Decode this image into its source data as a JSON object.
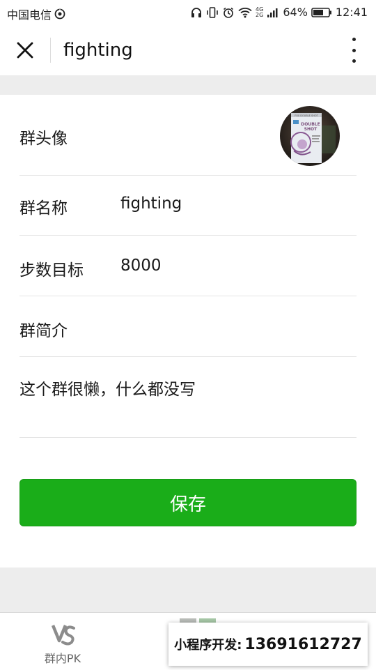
{
  "status_bar": {
    "carrier": "中国电信",
    "battery_percent": "64%",
    "time": "12:41",
    "network_top": "4G",
    "network_bottom": "2G",
    "icons": [
      "hotspot-icon",
      "headset-icon",
      "vibrate-icon",
      "alarm-icon",
      "wifi-icon",
      "signal-icon",
      "battery-icon"
    ]
  },
  "header": {
    "title": "fighting",
    "close_icon": "close-icon",
    "more_icon": "more-vertical-icon"
  },
  "form": {
    "avatar_label": "群头像",
    "avatar_image_text": {
      "top": "FOX DOUBLE SHOT",
      "line1": "DOUBLE",
      "line2": "SHOT"
    },
    "name_label": "群名称",
    "name_value": "fighting",
    "steps_label": "步数目标",
    "steps_value": "8000",
    "intro_label": "群简介",
    "intro_value": "这个群很懒，什么都没写",
    "save_label": "保存"
  },
  "tabbar": {
    "pk_label": "群内PK",
    "pk_icon": "vs-icon"
  },
  "promo": {
    "label": "小程序开发:",
    "phone": "13691612727"
  },
  "colors": {
    "accent_green": "#1aad19",
    "background_gray": "#ededed",
    "divider": "#e5e5e5"
  }
}
